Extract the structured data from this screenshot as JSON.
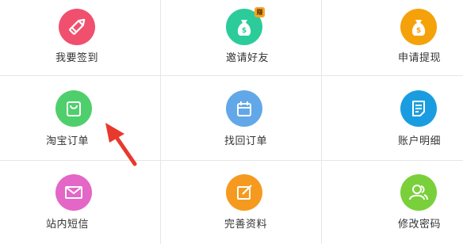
{
  "menu": {
    "checkin": {
      "label": "我要签到",
      "color": "#f0506e"
    },
    "invite": {
      "label": "邀请好友",
      "color": "#2ccb9a",
      "badge": "赚"
    },
    "withdraw": {
      "label": "申请提现",
      "color": "#f5a10a"
    },
    "taobao_order": {
      "label": "淘宝订单",
      "color": "#4fcf6c"
    },
    "retrieve_order": {
      "label": "找回订单",
      "color": "#62a8e8"
    },
    "account_detail": {
      "label": "账户明细",
      "color": "#1a9de0"
    },
    "messages": {
      "label": "站内短信",
      "color": "#e466c6"
    },
    "profile": {
      "label": "完善资料",
      "color": "#f59a1e"
    },
    "password": {
      "label": "修改密码",
      "color": "#7ad03a"
    }
  },
  "annotation": {
    "arrow_color": "#e8392c"
  }
}
